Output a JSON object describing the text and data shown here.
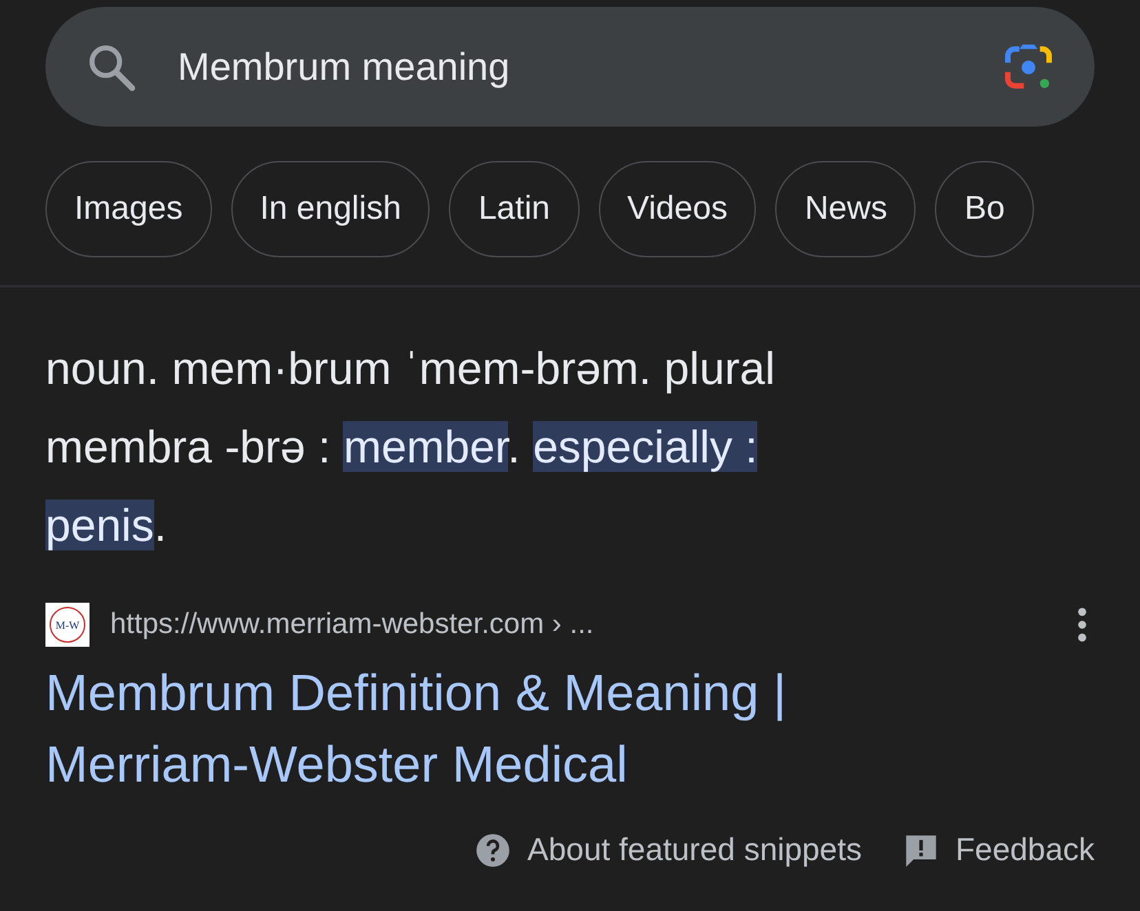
{
  "search": {
    "value": "Membrum meaning"
  },
  "chips": [
    {
      "label": "Images"
    },
    {
      "label": "In english"
    },
    {
      "label": "Latin"
    },
    {
      "label": "Videos"
    },
    {
      "label": "News"
    },
    {
      "label": "Bo"
    }
  ],
  "snippet": {
    "lines": [
      [
        {
          "text": "noun. mem·brum ˈmem-brəm. plural",
          "highlighted": false
        }
      ],
      [
        {
          "text": "membra -brə :",
          "highlighted": false
        },
        {
          "text": "member",
          "highlighted": true,
          "after": "."
        },
        {
          "text": "especially :",
          "highlighted": true
        }
      ],
      [
        {
          "text": "penis",
          "highlighted": true,
          "after": "."
        }
      ]
    ]
  },
  "result": {
    "favicon_text": "M-W",
    "url": "https://www.merriam-webster.com › ...",
    "title": "Membrum Definition & Meaning | Merriam-Webster Medical"
  },
  "footer": {
    "about": "About featured snippets",
    "feedback": "Feedback"
  }
}
